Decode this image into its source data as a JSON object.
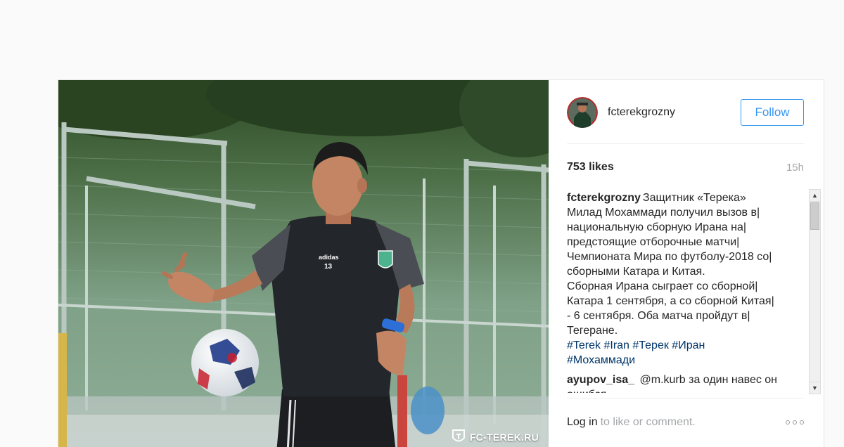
{
  "post": {
    "username": "fcterekgrozny",
    "follow_label": "Follow",
    "likes": "753 likes",
    "time": "15h",
    "caption_user": "fcterekgrozny",
    "caption_lines": [
      "Защитник «Терека»",
      "Милад Мохаммади получил вызов в|",
      "национальную сборную Ирана на|",
      "предстоящие отборочные матчи|",
      "Чемпионата Мира по футболу-2018 со|",
      "сборными Катара и Китая.",
      "Сборная Ирана сыграет со сборной|",
      "Катара 1 сентября, а со сборной Китая|",
      "- 6 сентября. Оба матча пройдут в|",
      "Тегеране."
    ],
    "hashtags_line1": "#Terek #Iran #Терек #Иран",
    "hashtags_line2": "#Мохаммади",
    "comment2_user": "ayupov_isa_",
    "comment2_text": "@m.kurb за один навес он",
    "comment2_cut": "ошибся",
    "login_link": "Log in",
    "login_rest": "to like or comment.",
    "watermark": "FC-TEREK.RU",
    "jersey_number": "13",
    "jersey_brand": "adidas"
  },
  "icons": [
    "avatar",
    "more-icon",
    "scroll-up-arrow-icon",
    "scroll-down-arrow-icon",
    "crest-icon"
  ],
  "colors": {
    "follow_blue": "#3897f0",
    "hashtag": "#003569",
    "muted": "#a5a7aa"
  }
}
